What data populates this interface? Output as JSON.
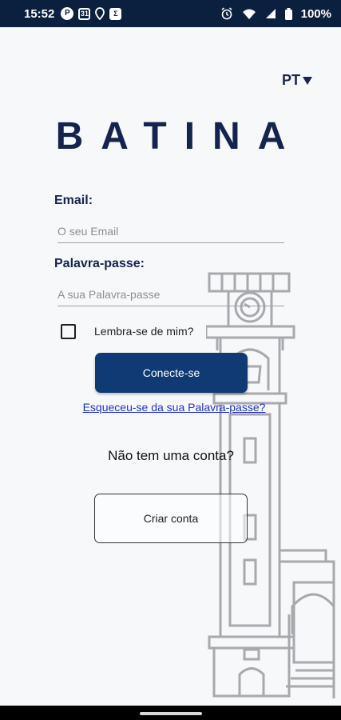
{
  "status_bar": {
    "time": "15:52",
    "battery": "100%",
    "icons": [
      "pinterest-icon",
      "calendar-icon",
      "location-icon",
      "sigma-app-icon",
      "alarm-icon",
      "wifi-icon",
      "signal-icon",
      "battery-icon"
    ]
  },
  "language": {
    "label": "PT",
    "icon": "caret-down-icon"
  },
  "logo": {
    "text": "BATINA"
  },
  "form": {
    "email_label": "Email:",
    "email_placeholder": "O seu Email",
    "password_label": "Palavra-passe:",
    "password_placeholder": "A sua Palavra-passe",
    "remember_label": "Lembra-se de mim?",
    "login_button": "Conecte-se",
    "forgot_link": "Esqueceu-se da sua Palavra-passe?"
  },
  "signup": {
    "prompt": "Não tem uma conta?",
    "button": "Criar conta"
  },
  "colors": {
    "primary": "#0f3a74",
    "brand_text": "#15244f",
    "link": "#2033c9",
    "status_bar": "#0b1f3f"
  }
}
